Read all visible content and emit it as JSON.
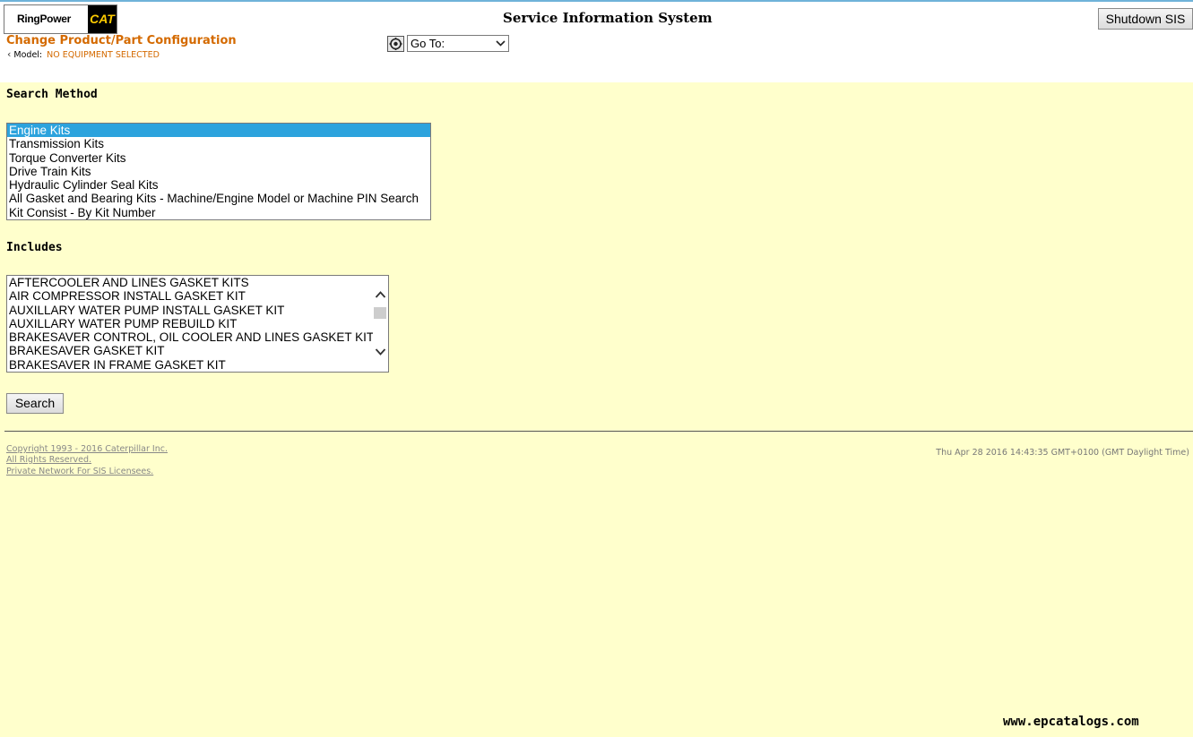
{
  "header": {
    "logo_text": "RingPower",
    "logo_brand": "CAT",
    "title": "Service Information System",
    "shutdown_label": "Shutdown SIS",
    "config_link": "Change Product/Part Configuration",
    "model_label": "Model:",
    "model_value": "NO EQUIPMENT SELECTED",
    "goto": {
      "icon": "gear-cog-icon",
      "selected": "Go To:"
    }
  },
  "search_method": {
    "heading": "Search Method",
    "options": [
      "Engine Kits",
      "Transmission Kits",
      "Torque Converter Kits",
      "Drive Train Kits",
      "Hydraulic Cylinder Seal Kits",
      "All Gasket and Bearing Kits - Machine/Engine Model or Machine PIN Search",
      "Kit Consist - By Kit Number"
    ],
    "selected_index": 0
  },
  "includes": {
    "heading": "Includes",
    "items": [
      "AFTERCOOLER AND LINES GASKET KITS",
      "AIR COMPRESSOR INSTALL GASKET KIT",
      "AUXILLARY WATER PUMP INSTALL GASKET KIT",
      "AUXILLARY WATER PUMP REBUILD KIT",
      "BRAKESAVER CONTROL, OIL COOLER AND LINES GASKET KIT",
      "BRAKESAVER GASKET KIT",
      "BRAKESAVER IN FRAME GASKET KIT"
    ]
  },
  "actions": {
    "search_label": "Search"
  },
  "footer": {
    "copyright": "Copyright 1993 - 2016 Caterpillar Inc.",
    "rights": "All Rights Reserved.",
    "network": "Private Network For SIS Licensees.",
    "timestamp": "Thu Apr 28 2016 14:43:35 GMT+0100 (GMT Daylight Time)"
  },
  "watermark": "www.epcatalogs.com",
  "colors": {
    "page_background": "#ffffcc",
    "accent_orange": "#d46a00",
    "selection_blue": "#2ca3dd",
    "top_border": "#6fb3d9"
  }
}
